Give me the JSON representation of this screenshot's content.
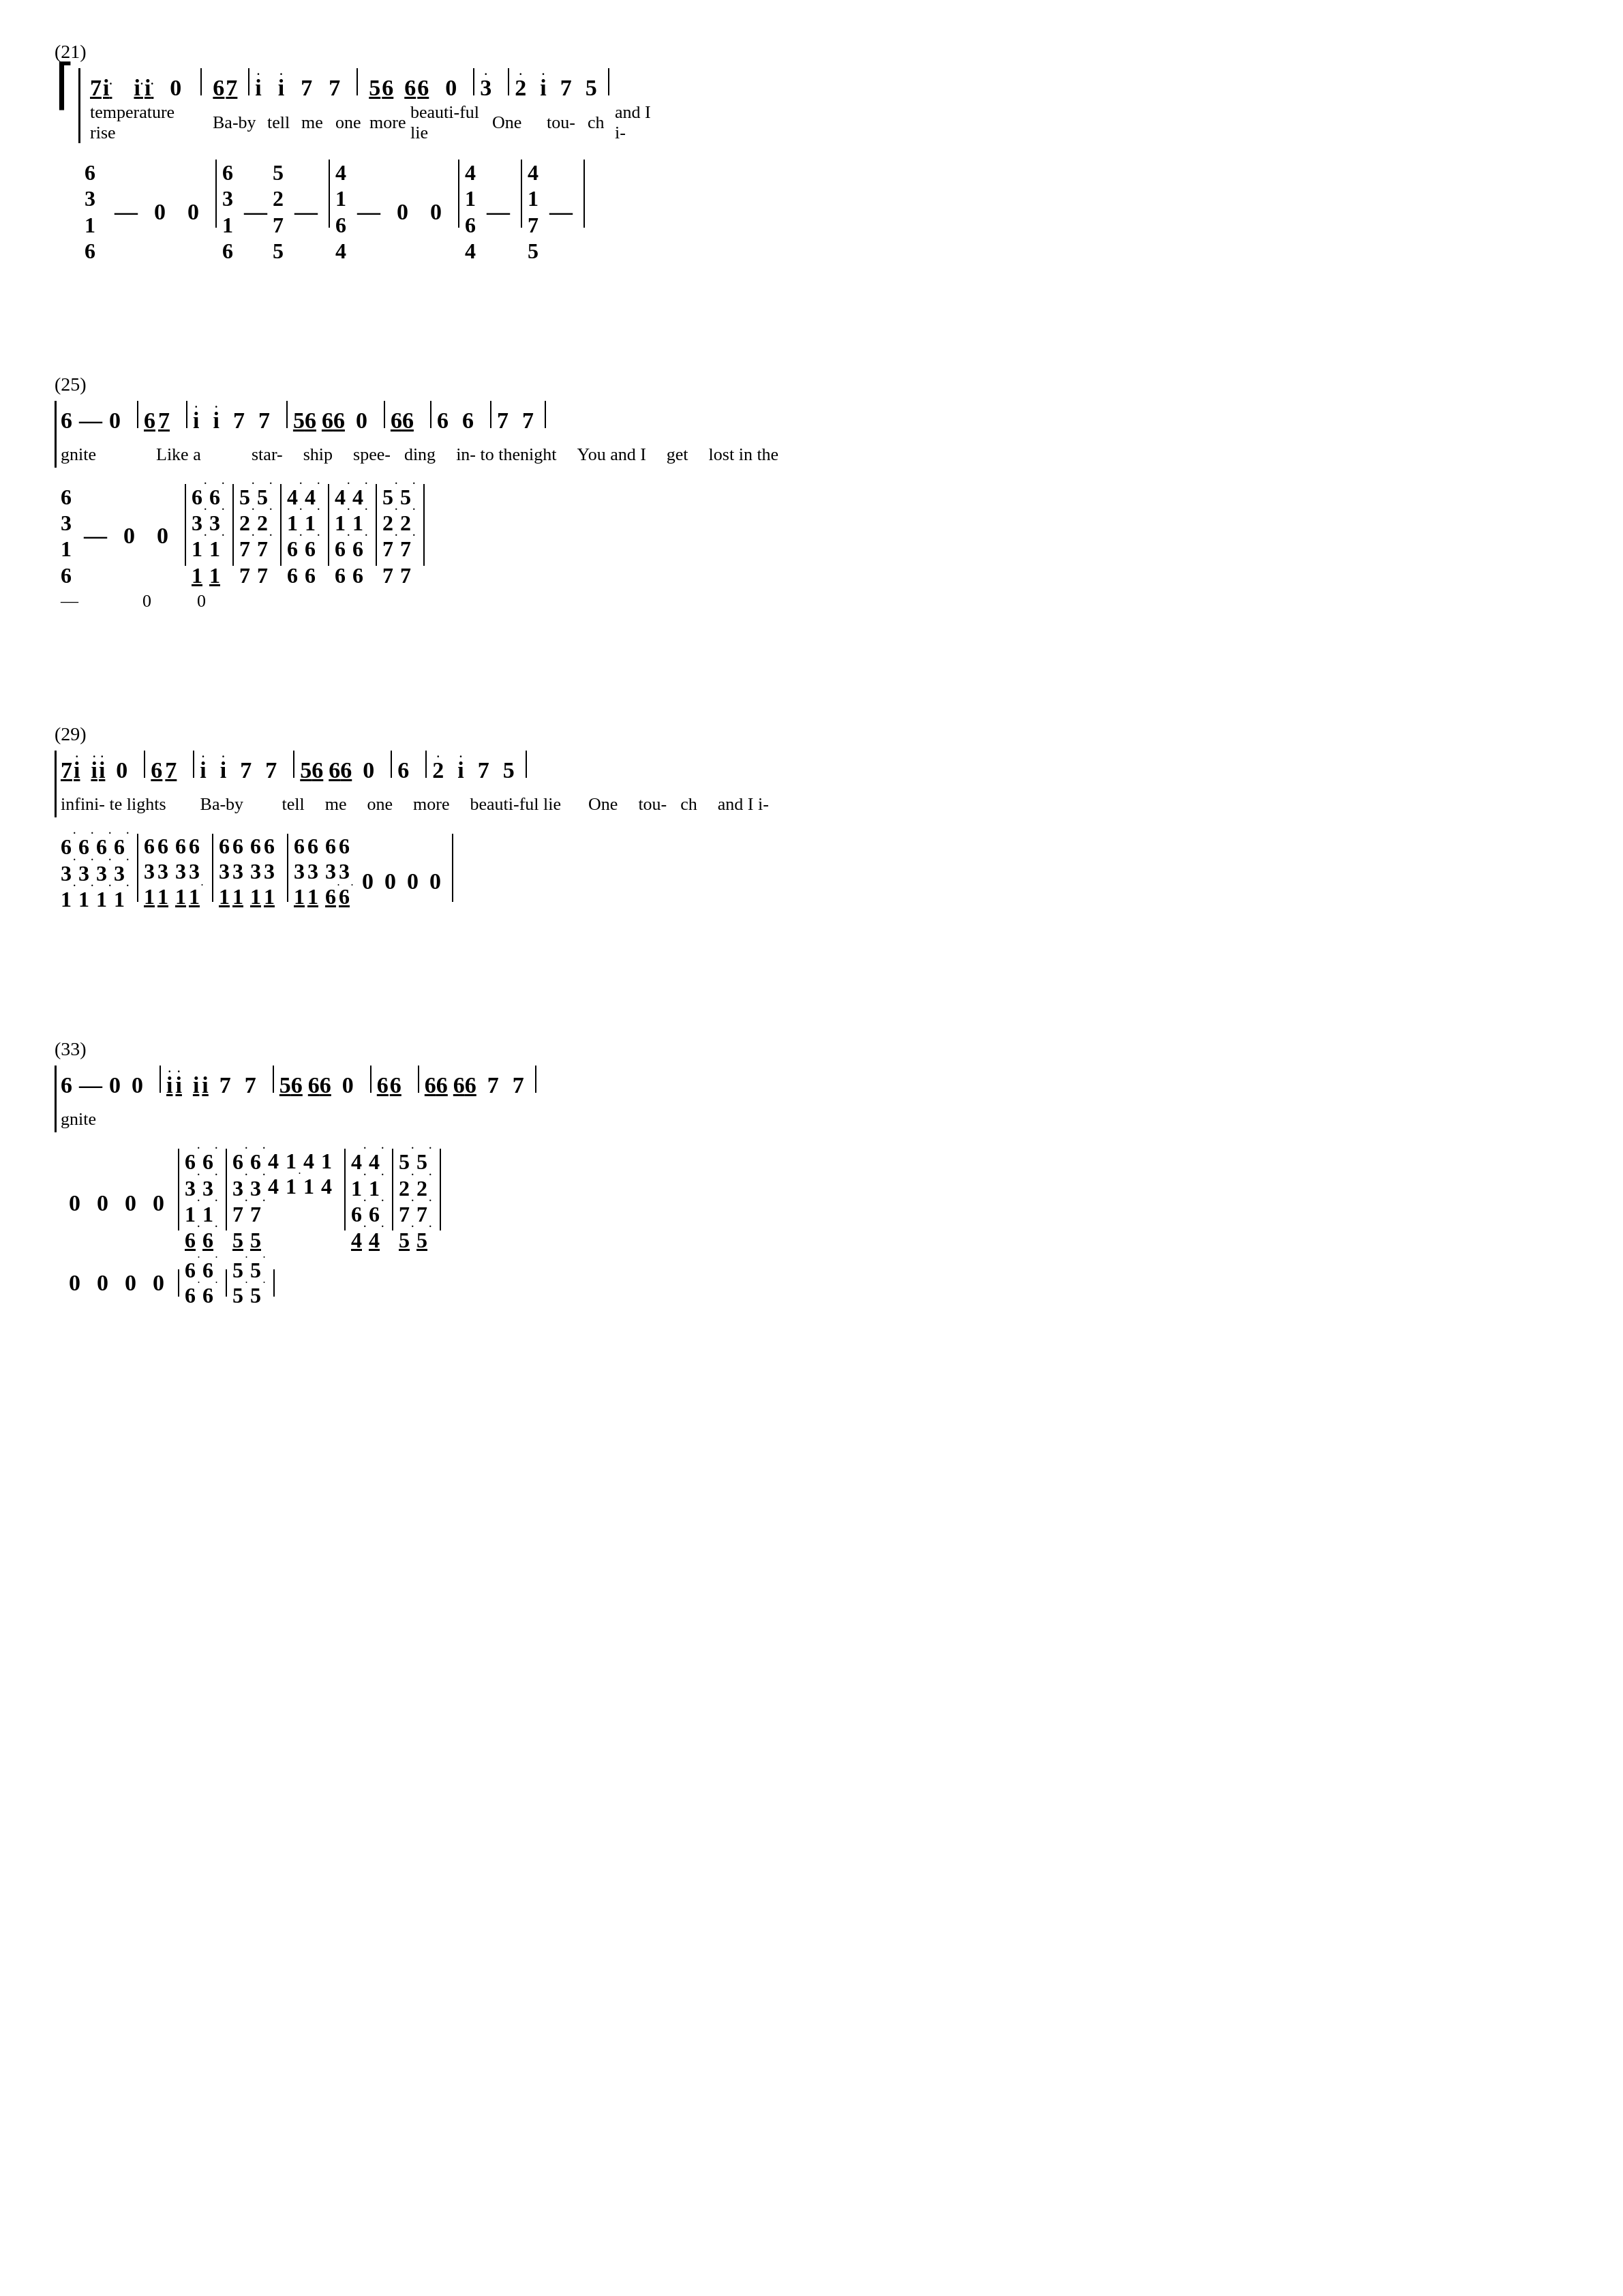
{
  "sections": [
    {
      "number": "(21)",
      "upper_voice": {
        "lyrics_top": "temperature rise",
        "notes": "7i ii 0 | 6 7 | i i 7 7 | 56 660 | 3(dot) | 2(dot) i 7 5",
        "lyrics_bottom": "Ba-by | tell me one more | beauti-ful lie | One | tou- ch and I i-"
      },
      "lower_voice": {
        "rows": "6/3/1/6 - 0 0 | 6/3/1/6 - 5/2/7/5 - | 4/1/6/4 - 0 0 | 4/1/6/4 - | 4/1/7/5 -"
      }
    },
    {
      "number": "(25)",
      "upper_voice": {
        "notes": "6 - 0 | 6 7 | i i 7 7 | 56 660 | 6 6 | 6 6 | 7 7",
        "lyrics": "gnite | Like a star- ship spee- ding | in- to thenight | You and I | get | lost in the"
      }
    },
    {
      "number": "(29)",
      "upper_voice": {
        "notes": "7i ii 0 | 6 7 | i i 7 7 | 56 660 | 6 | 2(dot) i 7 5",
        "lyrics": "infini- te lights | Ba-by | tell me one more | beauti-ful lie | One | tou- ch and I i-"
      }
    },
    {
      "number": "(33)",
      "upper_voice": {
        "notes": "6 - 0 0 | ii ii 7 7 | 56 660 | 6 6 | 6 6 6 6 7 7",
        "lyrics": "gnite"
      }
    }
  ]
}
